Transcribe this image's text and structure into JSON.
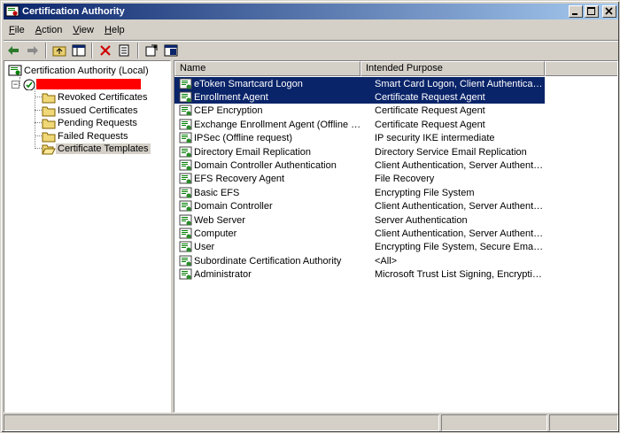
{
  "window": {
    "title": "Certification Authority",
    "title_icon": "certificate-icon",
    "buttons": [
      "minimize",
      "maximize",
      "close"
    ]
  },
  "menubar": {
    "items": [
      {
        "label": "File"
      },
      {
        "label": "Action"
      },
      {
        "label": "View"
      },
      {
        "label": "Help"
      }
    ]
  },
  "toolbar": {
    "icons": [
      "back-arrow-icon",
      "forward-arrow-icon",
      "up-folder-icon",
      "show-hide-tree-icon",
      "delete-icon",
      "export-list-icon",
      "properties-icon",
      "help-icon"
    ]
  },
  "tree": {
    "root_label": "Certification Authority (Local)",
    "ca_node_label": "",
    "ca_node_redacted": true,
    "folders": [
      {
        "label": "Revoked Certificates"
      },
      {
        "label": "Issued Certificates"
      },
      {
        "label": "Pending Requests"
      },
      {
        "label": "Failed Requests"
      },
      {
        "label": "Certificate Templates",
        "selected": true
      }
    ]
  },
  "list": {
    "columns": [
      {
        "label": "Name"
      },
      {
        "label": "Intended Purpose"
      },
      {
        "label": ""
      }
    ],
    "rows": [
      {
        "name": "eToken Smartcard Logon",
        "purpose": "Smart Card Logon, Client Authentication",
        "selected": true
      },
      {
        "name": "Enrollment Agent",
        "purpose": "Certificate Request Agent",
        "selected": true
      },
      {
        "name": "CEP Encryption",
        "purpose": "Certificate Request Agent"
      },
      {
        "name": "Exchange Enrollment Agent (Offline req...",
        "purpose": "Certificate Request Agent"
      },
      {
        "name": "IPSec (Offline request)",
        "purpose": "IP security IKE intermediate"
      },
      {
        "name": "Directory Email Replication",
        "purpose": "Directory Service Email Replication"
      },
      {
        "name": "Domain Controller Authentication",
        "purpose": "Client Authentication, Server Authenticatio..."
      },
      {
        "name": "EFS Recovery Agent",
        "purpose": "File Recovery"
      },
      {
        "name": "Basic EFS",
        "purpose": "Encrypting File System"
      },
      {
        "name": "Domain Controller",
        "purpose": "Client Authentication, Server Authentication"
      },
      {
        "name": "Web Server",
        "purpose": "Server Authentication"
      },
      {
        "name": "Computer",
        "purpose": "Client Authentication, Server Authentication"
      },
      {
        "name": "User",
        "purpose": "Encrypting File System, Secure Email, Clien..."
      },
      {
        "name": "Subordinate Certification Authority",
        "purpose": "<All>"
      },
      {
        "name": "Administrator",
        "purpose": "Microsoft Trust List Signing, Encrypting File..."
      }
    ]
  },
  "colors": {
    "title_gradient_start": "#0a246a",
    "title_gradient_end": "#a6caf0",
    "selection": "#0a246a",
    "redaction": "#ff0000",
    "face": "#d4d0c8"
  }
}
